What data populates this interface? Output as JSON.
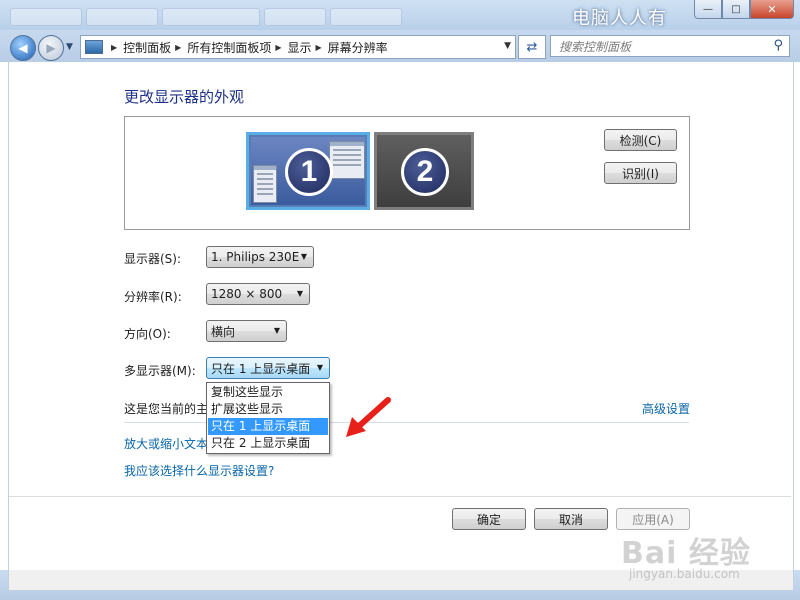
{
  "watermark": {
    "top_text": "电脑人人有",
    "baidu_text": "Bai 经验",
    "site_text": "jingyan.baidu.com"
  },
  "address_bar": {
    "crumbs": [
      "控制面板",
      "所有控制面板项",
      "显示",
      "屏幕分辨率"
    ],
    "search_placeholder": "搜索控制面板"
  },
  "page": {
    "heading": "更改显示器的外观",
    "monitors": [
      {
        "number": "1",
        "selected": true
      },
      {
        "number": "2",
        "selected": false
      }
    ],
    "detect_label": "检测(C)",
    "identify_label": "识别(I)",
    "fields": {
      "display": {
        "label": "显示器(S):",
        "value": "1. Philips 230E"
      },
      "resolution": {
        "label": "分辨率(R):",
        "value": "1280 × 800"
      },
      "orientation": {
        "label": "方向(O):",
        "value": "横向"
      },
      "multiple_displays": {
        "label": "多显示器(M):",
        "value": "只在 1 上显示桌面",
        "options": [
          "复制这些显示",
          "扩展这些显示",
          "只在 1 上显示桌面",
          "只在 2 上显示桌面"
        ],
        "highlighted_option": "只在 1 上显示桌面"
      }
    },
    "current_display_text_partial": "这是您当前的主",
    "advanced_settings_link": "高级设置",
    "zoom_text_link_partial": "放大或缩小文本",
    "which_settings_link": "我应该选择什么显示器设置?"
  },
  "footer": {
    "ok_label": "确定",
    "cancel_label": "取消",
    "apply_label": "应用(A)"
  },
  "colors": {
    "heading": "#1e3287",
    "link": "#0a66a8",
    "selection": "#3399ff",
    "arrow": "#e8201a"
  }
}
